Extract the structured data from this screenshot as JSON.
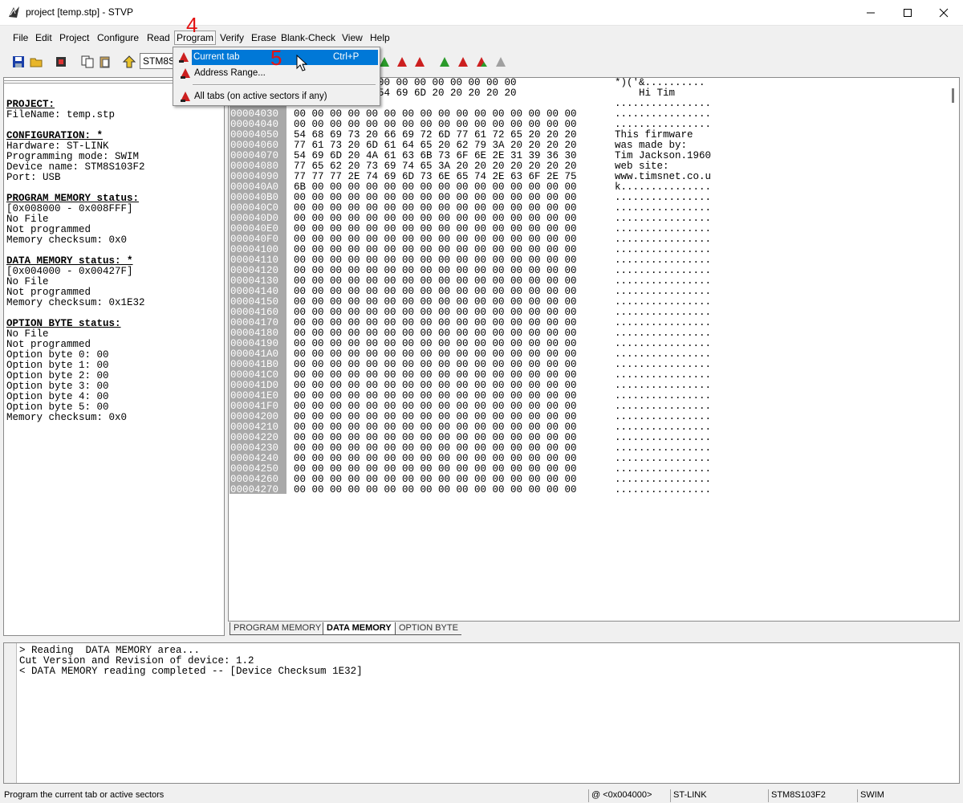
{
  "window": {
    "title": "project [temp.stp] - STVP",
    "controls": [
      "minimize",
      "maximize",
      "close"
    ]
  },
  "menubar": {
    "items": [
      "File",
      "Edit",
      "Project",
      "Configure",
      "Read",
      "Program",
      "Verify",
      "Erase",
      "Blank-Check",
      "View",
      "Help"
    ]
  },
  "toolbar": {
    "device_combo": "STM8S",
    "icons": [
      "save-icon",
      "open-icon",
      "chip-icon",
      "copy-icon",
      "paste-icon",
      "read-icon",
      "program-icon",
      "verify-icon",
      "erase-icon"
    ]
  },
  "program_menu": {
    "items": [
      {
        "label": "Current tab",
        "shortcut": "Ctrl+P"
      },
      {
        "label": "Address Range...",
        "shortcut": ""
      },
      {
        "label": "All tabs (on active sectors if any)",
        "shortcut": ""
      }
    ]
  },
  "annotations": {
    "step4": "4",
    "step5": "5"
  },
  "info": {
    "project_hdr": "PROJECT:",
    "filename": "FileName: temp.stp",
    "config_hdr": "CONFIGURATION: *",
    "hardware": "Hardware: ST-LINK",
    "mode": "Programming mode: SWIM",
    "device": "Device name: STM8S103F2",
    "port": "Port: USB",
    "prog_hdr": "PROGRAM MEMORY status:",
    "prog_range": "[0x008000 - 0x008FFF]",
    "prog_file": "No File",
    "prog_state": "Not programmed",
    "prog_checksum": "Memory checksum: 0x0",
    "data_hdr": "DATA MEMORY status: *",
    "data_range": "[0x004000 - 0x00427F]",
    "data_file": "No File",
    "data_state": "Not programmed",
    "data_checksum": "Memory checksum: 0x1E32",
    "opt_hdr": "OPTION BYTE status:",
    "opt_file": "No File",
    "opt_state": "Not programmed",
    "opt_bytes": [
      "Option byte 0: 00",
      "Option byte 1: 00",
      "Option byte 2: 00",
      "Option byte 3: 00",
      "Option byte 4: 00",
      "Option byte 5: 00"
    ],
    "opt_checksum": "Memory checksum: 0x0"
  },
  "hex": {
    "rows": [
      {
        "addr": "",
        "bytes": "     1E 00 00 00 00 00 00 00 00 00 00",
        "ascii": "*)('&.........."
      },
      {
        "addr": "",
        "bytes": "     48 69 20 54 69 6D 20 20 20 20 20",
        "ascii": "    Hi Tim"
      },
      {
        "addr": "",
        "bytes": "",
        "ascii": "................"
      },
      {
        "addr": "00004030",
        "bytes": "00 00 00 00 00 00 00 00 00 00 00 00 00 00 00 00",
        "ascii": "................"
      },
      {
        "addr": "00004040",
        "bytes": "00 00 00 00 00 00 00 00 00 00 00 00 00 00 00 00",
        "ascii": "................"
      },
      {
        "addr": "00004050",
        "bytes": "54 68 69 73 20 66 69 72 6D 77 61 72 65 20 20 20",
        "ascii": "This firmware"
      },
      {
        "addr": "00004060",
        "bytes": "77 61 73 20 6D 61 64 65 20 62 79 3A 20 20 20 20",
        "ascii": "was made by:"
      },
      {
        "addr": "00004070",
        "bytes": "54 69 6D 20 4A 61 63 6B 73 6F 6E 2E 31 39 36 30",
        "ascii": "Tim Jackson.1960"
      },
      {
        "addr": "00004080",
        "bytes": "77 65 62 20 73 69 74 65 3A 20 20 20 20 20 20 20",
        "ascii": "web site:"
      },
      {
        "addr": "00004090",
        "bytes": "77 77 77 2E 74 69 6D 73 6E 65 74 2E 63 6F 2E 75",
        "ascii": "www.timsnet.co.u"
      },
      {
        "addr": "000040A0",
        "bytes": "6B 00 00 00 00 00 00 00 00 00 00 00 00 00 00 00",
        "ascii": "k..............."
      },
      {
        "addr": "000040B0",
        "bytes": "00 00 00 00 00 00 00 00 00 00 00 00 00 00 00 00",
        "ascii": "................"
      },
      {
        "addr": "000040C0",
        "bytes": "00 00 00 00 00 00 00 00 00 00 00 00 00 00 00 00",
        "ascii": "................"
      },
      {
        "addr": "000040D0",
        "bytes": "00 00 00 00 00 00 00 00 00 00 00 00 00 00 00 00",
        "ascii": "................"
      },
      {
        "addr": "000040E0",
        "bytes": "00 00 00 00 00 00 00 00 00 00 00 00 00 00 00 00",
        "ascii": "................"
      },
      {
        "addr": "000040F0",
        "bytes": "00 00 00 00 00 00 00 00 00 00 00 00 00 00 00 00",
        "ascii": "................"
      },
      {
        "addr": "00004100",
        "bytes": "00 00 00 00 00 00 00 00 00 00 00 00 00 00 00 00",
        "ascii": "................"
      },
      {
        "addr": "00004110",
        "bytes": "00 00 00 00 00 00 00 00 00 00 00 00 00 00 00 00",
        "ascii": "................"
      },
      {
        "addr": "00004120",
        "bytes": "00 00 00 00 00 00 00 00 00 00 00 00 00 00 00 00",
        "ascii": "................"
      },
      {
        "addr": "00004130",
        "bytes": "00 00 00 00 00 00 00 00 00 00 00 00 00 00 00 00",
        "ascii": "................"
      },
      {
        "addr": "00004140",
        "bytes": "00 00 00 00 00 00 00 00 00 00 00 00 00 00 00 00",
        "ascii": "................"
      },
      {
        "addr": "00004150",
        "bytes": "00 00 00 00 00 00 00 00 00 00 00 00 00 00 00 00",
        "ascii": "................"
      },
      {
        "addr": "00004160",
        "bytes": "00 00 00 00 00 00 00 00 00 00 00 00 00 00 00 00",
        "ascii": "................"
      },
      {
        "addr": "00004170",
        "bytes": "00 00 00 00 00 00 00 00 00 00 00 00 00 00 00 00",
        "ascii": "................"
      },
      {
        "addr": "00004180",
        "bytes": "00 00 00 00 00 00 00 00 00 00 00 00 00 00 00 00",
        "ascii": "................"
      },
      {
        "addr": "00004190",
        "bytes": "00 00 00 00 00 00 00 00 00 00 00 00 00 00 00 00",
        "ascii": "................"
      },
      {
        "addr": "000041A0",
        "bytes": "00 00 00 00 00 00 00 00 00 00 00 00 00 00 00 00",
        "ascii": "................"
      },
      {
        "addr": "000041B0",
        "bytes": "00 00 00 00 00 00 00 00 00 00 00 00 00 00 00 00",
        "ascii": "................"
      },
      {
        "addr": "000041C0",
        "bytes": "00 00 00 00 00 00 00 00 00 00 00 00 00 00 00 00",
        "ascii": "................"
      },
      {
        "addr": "000041D0",
        "bytes": "00 00 00 00 00 00 00 00 00 00 00 00 00 00 00 00",
        "ascii": "................"
      },
      {
        "addr": "000041E0",
        "bytes": "00 00 00 00 00 00 00 00 00 00 00 00 00 00 00 00",
        "ascii": "................"
      },
      {
        "addr": "000041F0",
        "bytes": "00 00 00 00 00 00 00 00 00 00 00 00 00 00 00 00",
        "ascii": "................"
      },
      {
        "addr": "00004200",
        "bytes": "00 00 00 00 00 00 00 00 00 00 00 00 00 00 00 00",
        "ascii": "................"
      },
      {
        "addr": "00004210",
        "bytes": "00 00 00 00 00 00 00 00 00 00 00 00 00 00 00 00",
        "ascii": "................"
      },
      {
        "addr": "00004220",
        "bytes": "00 00 00 00 00 00 00 00 00 00 00 00 00 00 00 00",
        "ascii": "................"
      },
      {
        "addr": "00004230",
        "bytes": "00 00 00 00 00 00 00 00 00 00 00 00 00 00 00 00",
        "ascii": "................"
      },
      {
        "addr": "00004240",
        "bytes": "00 00 00 00 00 00 00 00 00 00 00 00 00 00 00 00",
        "ascii": "................"
      },
      {
        "addr": "00004250",
        "bytes": "00 00 00 00 00 00 00 00 00 00 00 00 00 00 00 00",
        "ascii": "................"
      },
      {
        "addr": "00004260",
        "bytes": "00 00 00 00 00 00 00 00 00 00 00 00 00 00 00 00",
        "ascii": "................"
      },
      {
        "addr": "00004270",
        "bytes": "00 00 00 00 00 00 00 00 00 00 00 00 00 00 00 00",
        "ascii": "................"
      }
    ]
  },
  "tabs": [
    {
      "label": "PROGRAM MEMORY",
      "active": false
    },
    {
      "label": "DATA MEMORY",
      "active": true
    },
    {
      "label": "OPTION BYTE",
      "active": false
    }
  ],
  "log": {
    "lines": [
      "> Reading  DATA MEMORY area...",
      "Cut Version and Revision of device: 1.2",
      "< DATA MEMORY reading completed -- [Device Checksum 1E32]"
    ]
  },
  "statusbar": {
    "hint": "Program the current tab or active sectors",
    "address": "@ <0x004000>",
    "hardware": "ST-LINK",
    "device": "STM8S103F2",
    "mode": "SWIM"
  },
  "colors": {
    "highlight": "#0078d7",
    "address_column": "#a9a9a9",
    "annotation": "#e31414"
  }
}
